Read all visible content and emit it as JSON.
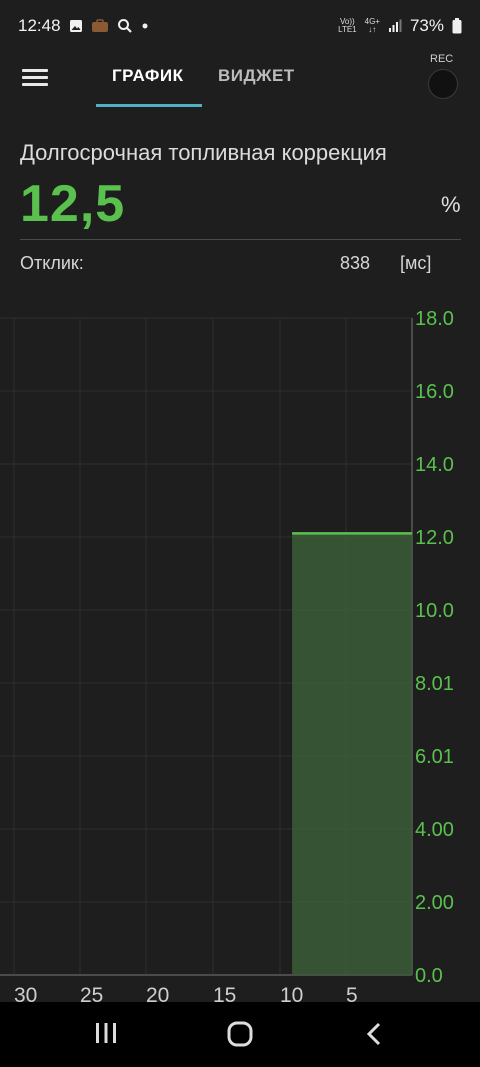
{
  "status_bar": {
    "time": "12:48",
    "volte_top": "Vo))",
    "volte_bottom": "LTE1",
    "network_top": "4G+",
    "network_bottom": "↓↑",
    "battery": "73%",
    "icons": [
      "image-icon",
      "briefcase-icon",
      "search-icon",
      "dot-icon",
      "signal-icon",
      "battery-icon"
    ]
  },
  "app_bar": {
    "tabs": [
      {
        "label": "ГРАФИК",
        "active": true
      },
      {
        "label": "ВИДЖЕТ",
        "active": false
      }
    ],
    "rec_label": "REC"
  },
  "parameter": {
    "name": "Долгосрочная топливная коррекция",
    "value": "12,5",
    "unit": "%",
    "response_label": "Отклик:",
    "response_value": "838",
    "response_unit": "[мс]"
  },
  "colors": {
    "accent_green": "#5ac14e",
    "fill_green": "#3b5e37",
    "tab_indicator": "#4fb0c6"
  },
  "chart_data": {
    "type": "area",
    "x_ticks": [
      "30",
      "25",
      "20",
      "15",
      "10",
      "5"
    ],
    "y_ticks": [
      "18.0",
      "16.0",
      "14.0",
      "12.0",
      "10.0",
      "8.01",
      "6.01",
      "4.00",
      "2.00",
      "0.0"
    ],
    "ylim": [
      0,
      18
    ],
    "x_data_range": [
      0,
      9
    ],
    "series": [
      {
        "x": [
          9,
          0
        ],
        "y": [
          12.1,
          12.1
        ]
      }
    ],
    "grid": true
  }
}
